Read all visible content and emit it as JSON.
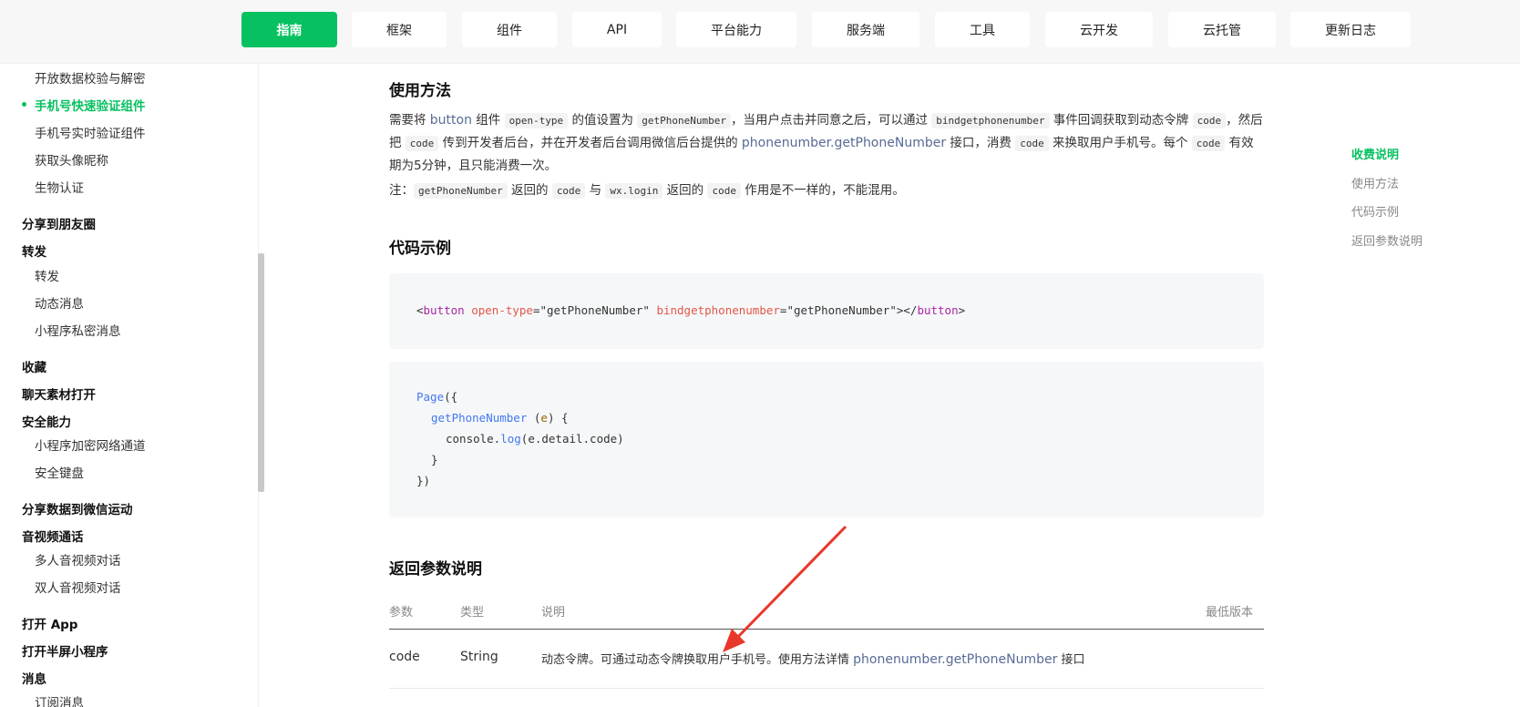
{
  "nav": {
    "tabs": [
      {
        "label": "指南",
        "active": true
      },
      {
        "label": "框架"
      },
      {
        "label": "组件"
      },
      {
        "label": "API"
      },
      {
        "label": "平台能力"
      },
      {
        "label": "服务端"
      },
      {
        "label": "工具"
      },
      {
        "label": "云开发"
      },
      {
        "label": "云托管"
      },
      {
        "label": "更新日志"
      }
    ]
  },
  "sidebar": {
    "items": [
      {
        "label": "开放数据校验与解密",
        "kind": "sub"
      },
      {
        "label": "手机号快速验证组件",
        "kind": "sub",
        "active": true
      },
      {
        "label": "手机号实时验证组件",
        "kind": "sub"
      },
      {
        "label": "获取头像昵称",
        "kind": "sub"
      },
      {
        "label": "生物认证",
        "kind": "sub"
      },
      {
        "label": "分享到朋友圈",
        "kind": "group"
      },
      {
        "label": "转发",
        "kind": "group"
      },
      {
        "label": "转发",
        "kind": "sub"
      },
      {
        "label": "动态消息",
        "kind": "sub"
      },
      {
        "label": "小程序私密消息",
        "kind": "sub"
      },
      {
        "label": "收藏",
        "kind": "group"
      },
      {
        "label": "聊天素材打开",
        "kind": "group"
      },
      {
        "label": "安全能力",
        "kind": "group"
      },
      {
        "label": "小程序加密网络通道",
        "kind": "sub"
      },
      {
        "label": "安全键盘",
        "kind": "sub"
      },
      {
        "label": "分享数据到微信运动",
        "kind": "group"
      },
      {
        "label": "音视频通话",
        "kind": "group"
      },
      {
        "label": "多人音视频对话",
        "kind": "sub"
      },
      {
        "label": "双人音视频对话",
        "kind": "sub"
      },
      {
        "label": "打开 App",
        "kind": "group"
      },
      {
        "label": "打开半屏小程序",
        "kind": "group"
      },
      {
        "label": "消息",
        "kind": "group"
      },
      {
        "label": "订阅消息",
        "kind": "sub"
      }
    ]
  },
  "usage": {
    "heading": "使用方法",
    "p1": {
      "t1": "需要将 ",
      "link_button": "button",
      "t2": " 组件 ",
      "code_open_type": "open-type",
      "t3": " 的值设置为 ",
      "code_get_phone": "getPhoneNumber",
      "t4": "，当用户点击并同意之后，可以通过 ",
      "code_bind": "bindgetphonenumber",
      "t5": " 事件回调获取到动态令牌 ",
      "code_code1": "code",
      "t6": "，然后把 ",
      "code_code2": "code",
      "t7": " 传到开发者后台，并在开发者后台调用微信后台提供的 ",
      "link_api": "phonenumber.getPhoneNumber",
      "t8": " 接口，消费 ",
      "code_code3": "code",
      "t9": " 来换取用户手机号。每个 ",
      "code_code4": "code",
      "t10": " 有效期为5分钟，且只能消费一次。"
    },
    "p2": {
      "t1": "注：",
      "code_get_phone": "getPhoneNumber",
      "t2": " 返回的 ",
      "code_code1": "code",
      "t3": " 与 ",
      "code_wxlogin": "wx.login",
      "t4": " 返回的 ",
      "code_code2": "code",
      "t5": " 作用是不一样的，不能混用。"
    }
  },
  "example": {
    "heading": "代码示例",
    "block1": {
      "lt": "<",
      "tag": "button",
      "attr1": "open-type",
      "eq1": "=",
      "val1": "\"getPhoneNumber\"",
      "attr2": "bindgetphonenumber",
      "eq2": "=",
      "val2": "\"getPhoneNumber\"",
      "close1": "></",
      "tag2": "button",
      "close2": ">"
    },
    "block2": {
      "l1_fn": "Page",
      "l1_rest": "({",
      "l2_fn": "getPhoneNumber",
      "l2_open": " (",
      "l2_param": "e",
      "l2_close": ") {",
      "l3_obj": "console.",
      "l3_fn": "log",
      "l3_rest": "(e.detail.code)",
      "l4": "}",
      "l5": "})"
    }
  },
  "params": {
    "heading": "返回参数说明",
    "headers": {
      "param": "参数",
      "type": "类型",
      "desc": "说明",
      "version": "最低版本"
    },
    "row": {
      "param": "code",
      "type": "String",
      "desc_text": "动态令牌。可通过动态令牌换取用户手机号。使用方法详情 ",
      "desc_link": "phonenumber.getPhoneNumber",
      "desc_tail": " 接口"
    }
  },
  "toc": {
    "items": [
      {
        "label": "收费说明",
        "active": true
      },
      {
        "label": "使用方法"
      },
      {
        "label": "代码示例"
      },
      {
        "label": "返回参数说明"
      }
    ]
  },
  "colors": {
    "accent": "#07c160",
    "link": "#576b95",
    "annotation": "#e8372b"
  }
}
